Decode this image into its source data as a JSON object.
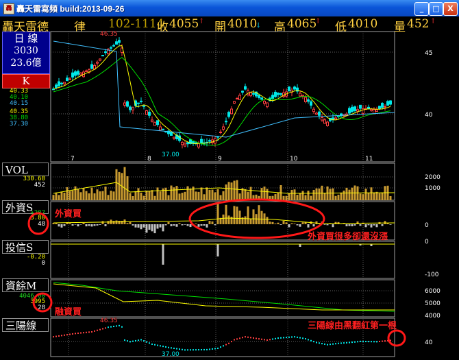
{
  "window": {
    "title": "轟天雷寫頻 build:2013-09-26",
    "minimize": "_",
    "maximize": "□",
    "close": "X"
  },
  "quote": {
    "stock_name": "轟天雷德",
    "mode": "律",
    "code": "102-1114",
    "close_label": "收",
    "close": "4055",
    "open_label": "開",
    "open": "4010",
    "high_label": "高",
    "high": "4065",
    "low_label": "低",
    "low": "4010",
    "volume_label": "量",
    "volume": "452"
  },
  "sidebar": {
    "period": "日 線",
    "value1": "3030",
    "value2": "23.6億",
    "k_label": "K",
    "ma_top": [
      "40.33",
      "40.10",
      "40.15"
    ],
    "ma_bottom": [
      "40.35",
      "38.80",
      "37.30"
    ],
    "vol_label": "VOL",
    "vol_values": [
      "330.60",
      "452"
    ],
    "foreign_label": "外資S",
    "foreign_values": [
      "3.80",
      "48"
    ],
    "trust_label": "投信S",
    "trust_values": [
      "-0.20",
      "0"
    ],
    "margin_label": "資餘M",
    "margin_values": [
      "4046.00",
      "3995",
      "-28"
    ],
    "sun_label": "三陽線",
    "foreign_extra": "+287"
  },
  "annotations": {
    "foreign_buy": "外資買",
    "foreign_note": "外資買很多卻還沒漲",
    "margin_buy": "融資買",
    "sun_note": "三陽線由黑翻紅第一根"
  },
  "colors": {
    "up": "#ff4040",
    "down": "#00e8e8",
    "ma_fast": "#ffff00",
    "ma_mid": "#00e000",
    "ma_slow": "#40c0ff",
    "vol_bar": "#c89a30",
    "grid": "#606060",
    "annot": "#ff1818"
  },
  "chart_data": [
    {
      "type": "candlestick",
      "title": "K",
      "x_tick_labels": [
        "7",
        "8",
        "9",
        "10",
        "11"
      ],
      "y_tick_labels": [
        "45",
        "40"
      ],
      "annotations": [
        "46.35",
        "37.00"
      ],
      "ylim": [
        36,
        47
      ]
    },
    {
      "type": "bar",
      "title": "VOL",
      "y_tick_labels": [
        "2000",
        "1000"
      ]
    },
    {
      "type": "bar",
      "title": "外資S",
      "y_tick_labels": [
        "0"
      ]
    },
    {
      "type": "bar",
      "title": "投信S",
      "y_tick_labels": [
        "0",
        "-100"
      ]
    },
    {
      "type": "line",
      "title": "資餘M",
      "y_tick_labels": [
        "6000",
        "5000",
        "4000"
      ]
    },
    {
      "type": "line",
      "title": "三陽線",
      "y_tick_labels": [
        "40"
      ],
      "annotations": [
        "46.35",
        "37.00"
      ]
    }
  ]
}
